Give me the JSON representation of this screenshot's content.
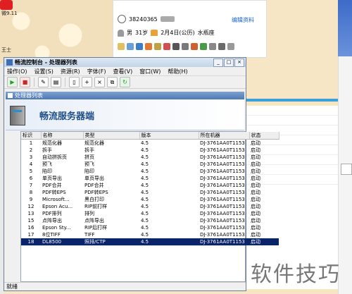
{
  "desktop": {
    "icon1_label": "微9.11",
    "icon2_label": "王士"
  },
  "profile": {
    "qq_number": "38240365",
    "edit_label": "编辑资料",
    "gender": "男",
    "age": "31岁",
    "birthday": "2月4日(公历)",
    "zodiac": "水瓶座"
  },
  "window": {
    "title": "畅流控制台 - 处理器列表",
    "menu": [
      "操作(O)",
      "设置(S)",
      "资源(R)",
      "字体(F)",
      "查看(V)",
      "窗口(W)",
      "帮助(H)"
    ],
    "inner_title": "处理器列表",
    "banner_title": "畅流服务器端",
    "status": "就绪"
  },
  "table": {
    "headers": [
      "标识",
      "名称",
      "类型",
      "版本",
      "所在机器",
      "状态"
    ],
    "rows": [
      {
        "id": "1",
        "name": "规范化器",
        "type": "规范化器",
        "ver": "4.5",
        "machine": "DJ-3761AA0T1153",
        "state": "启动"
      },
      {
        "id": "2",
        "name": "拆手",
        "type": "拆手",
        "ver": "4.5",
        "machine": "DJ-3761AA0T1153",
        "state": "启动"
      },
      {
        "id": "3",
        "name": "自动拼拆页",
        "type": "拼页",
        "ver": "4.5",
        "machine": "DJ-3761AA0T1153",
        "state": "启动"
      },
      {
        "id": "4",
        "name": "预飞",
        "type": "预飞",
        "ver": "4.5",
        "machine": "DJ-3761AA0T1153",
        "state": "启动"
      },
      {
        "id": "5",
        "name": "陷印",
        "type": "陷印",
        "ver": "4.5",
        "machine": "DJ-3761AA0T1153",
        "state": "启动"
      },
      {
        "id": "6",
        "name": "单页导出",
        "type": "单页导出",
        "ver": "4.5",
        "machine": "DJ-3761AA0T1153",
        "state": "启动"
      },
      {
        "id": "7",
        "name": "PDF合并",
        "type": "PDF合并",
        "ver": "4.5",
        "machine": "DJ-3761AA0T1153",
        "state": "启动"
      },
      {
        "id": "8",
        "name": "PDF转EPS",
        "type": "PDF转EPS",
        "ver": "4.5",
        "machine": "DJ-3761AA0T1153",
        "state": "启动"
      },
      {
        "id": "9",
        "name": "Microsoft...",
        "type": "黑白打印",
        "ver": "4.5",
        "machine": "DJ-3761AA0T1153",
        "state": "启动"
      },
      {
        "id": "12",
        "name": "Epson Acu...",
        "type": "RIP前打样",
        "ver": "4.5",
        "machine": "DJ-3761AA0T1153",
        "state": "启动"
      },
      {
        "id": "13",
        "name": "PDF排列",
        "type": "排列",
        "ver": "4.5",
        "machine": "DJ-3761AA0T1153",
        "state": "启动"
      },
      {
        "id": "15",
        "name": "点阵导出",
        "type": "点阵导出",
        "ver": "4.5",
        "machine": "DJ-3761AA0T1153",
        "state": "启动"
      },
      {
        "id": "16",
        "name": "Epson Sty...",
        "type": "RIP后打样",
        "ver": "4.5",
        "machine": "DJ-3761AA0T1153",
        "state": "启动"
      },
      {
        "id": "17",
        "name": "8位TIFF",
        "type": "TIFF",
        "ver": "4.5",
        "machine": "DJ-3761AA0T1153",
        "state": "启动"
      },
      {
        "id": "18",
        "name": "DL8500",
        "type": "照排/CTP",
        "ver": "4.5",
        "machine": "DJ-3761AA0T1153",
        "state": "启动"
      }
    ]
  },
  "watermark": "软件技巧"
}
